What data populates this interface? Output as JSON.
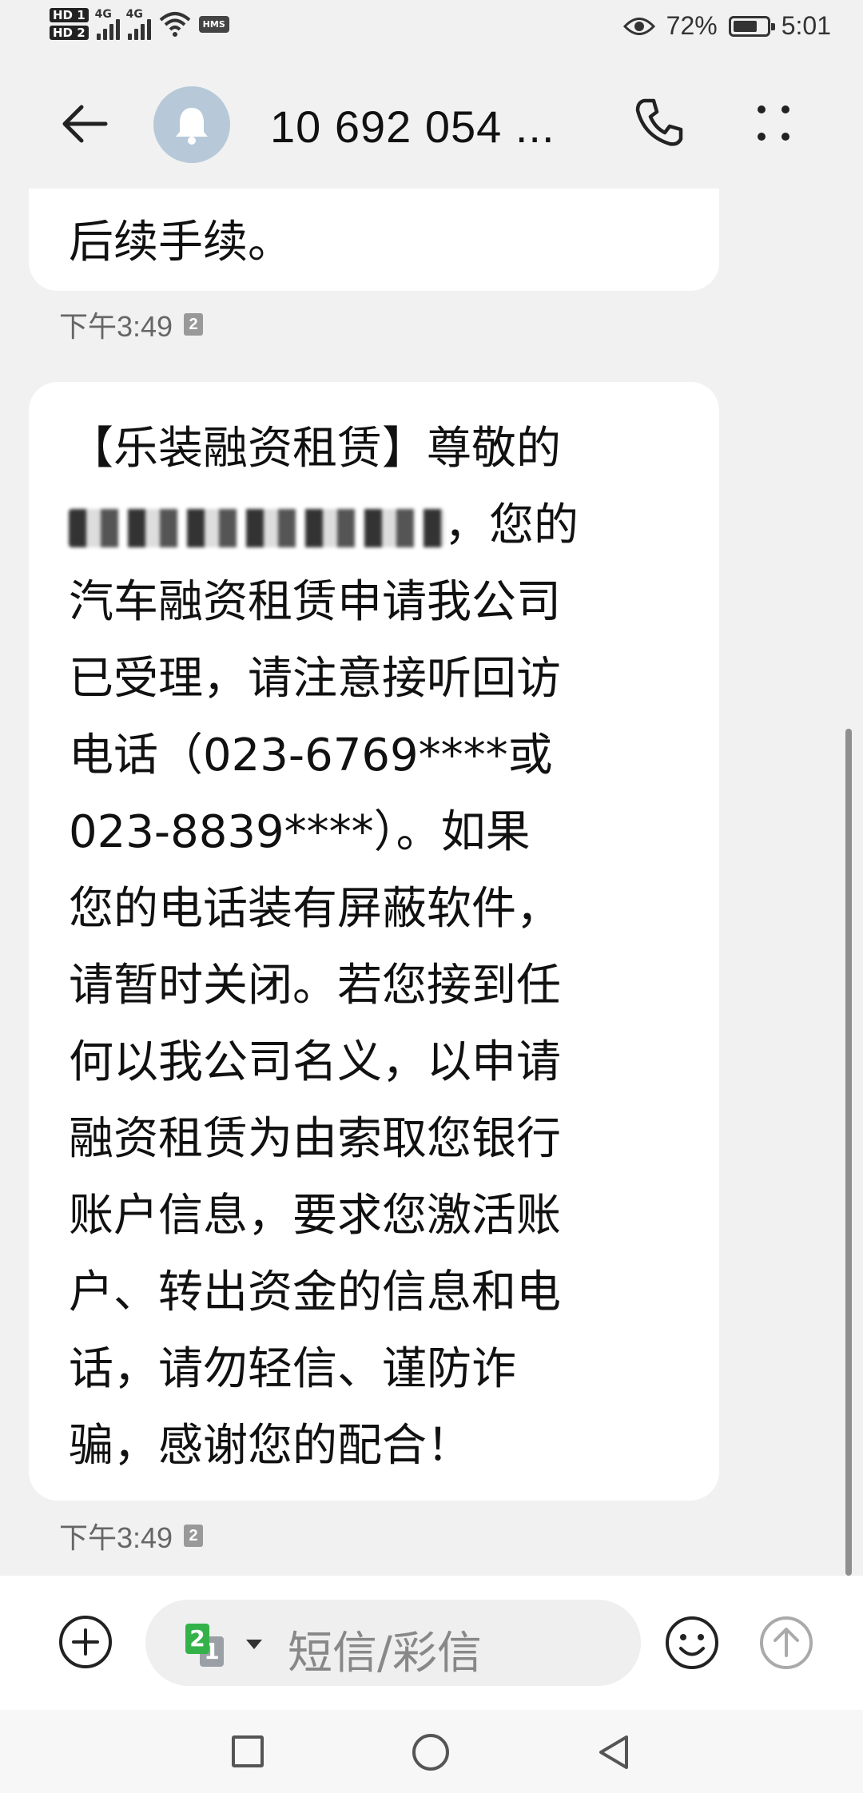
{
  "status_bar": {
    "hd1": "HD 1",
    "hd2": "HD 2",
    "net1": "4G",
    "net2": "4G",
    "hms": "HMS",
    "battery_percent": "72%",
    "battery_level": 0.72,
    "time": "5:01"
  },
  "header": {
    "contact": "10 692 054 ...",
    "icons": [
      "back-arrow-icon",
      "bell-icon",
      "phone-icon",
      "more-icon"
    ]
  },
  "messages": [
    {
      "lines": [
        "后续手续。"
      ],
      "time": "下午3:49",
      "sim": "2"
    },
    {
      "lines": [
        "【乐装融资租赁】尊敬的",
        "，您的",
        "汽车融资租赁申请我公司",
        "已受理，请注意接听回访",
        "电话（023-6769****或",
        "023-8839****）。如果",
        "您的电话装有屏蔽软件，",
        "请暂时关闭。若您接到任",
        "何以我公司名义，以申请",
        "融资租赁为由索取您银行",
        "账户信息，要求您激活账",
        "户、转出资金的信息和电",
        "话，请勿轻信、谨防诈",
        "骗，感谢您的配合！"
      ],
      "time": "下午3:49",
      "sim": "2"
    }
  ],
  "composer": {
    "sim_front": "2",
    "sim_back": "1",
    "placeholder": "短信/彩信"
  },
  "colors": {
    "background": "#f1f1f1",
    "bubble": "#ffffff",
    "sim_green": "#34b24a"
  }
}
